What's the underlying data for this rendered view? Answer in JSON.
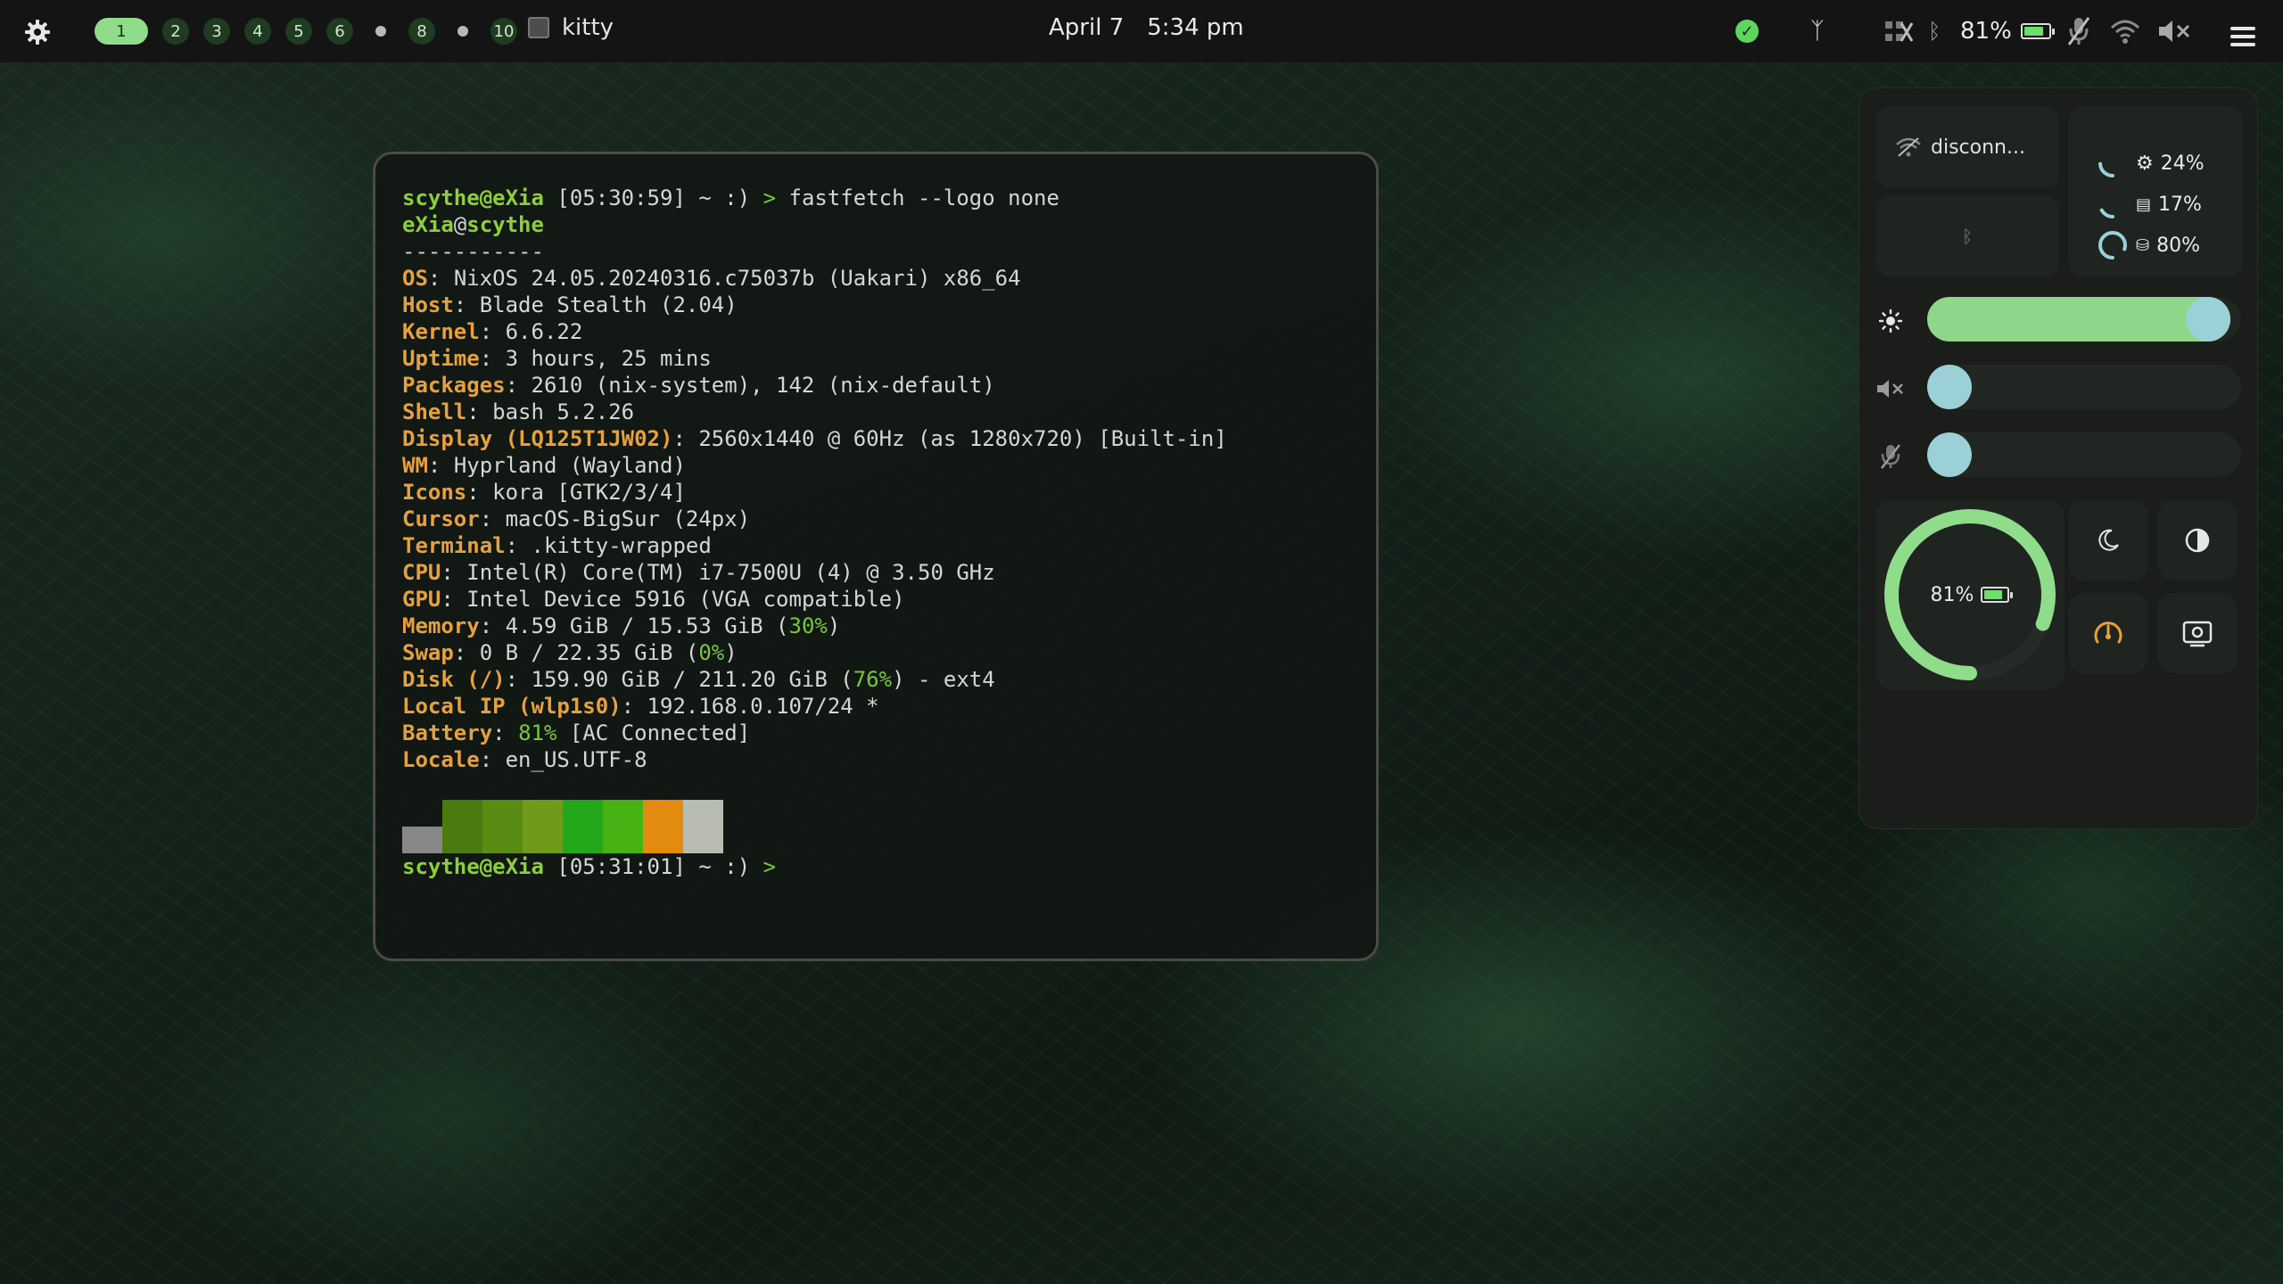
{
  "topbar": {
    "workspaces": [
      {
        "label": "1",
        "active": true
      },
      {
        "label": "2"
      },
      {
        "label": "3"
      },
      {
        "label": "4"
      },
      {
        "label": "5"
      },
      {
        "label": "6"
      },
      {
        "label": ""
      },
      {
        "label": "8"
      },
      {
        "label": ""
      },
      {
        "label": "10"
      }
    ],
    "window_title": "kitty",
    "date": "April 7",
    "time": "5:34 pm",
    "battery_percent": "81%"
  },
  "terminal": {
    "prompt1": {
      "user": "scythe@eXia",
      "time": "[05:30:59]",
      "path": "~ :)",
      "arrow": ">",
      "command": "fastfetch --logo none"
    },
    "host_user": "eXia",
    "host_at": "@",
    "host_name": "scythe",
    "separator": "-----------",
    "info": [
      {
        "key": "OS",
        "value": "NixOS 24.05.20240316.c75037b (Uakari) x86_64"
      },
      {
        "key": "Host",
        "value": "Blade Stealth (2.04)"
      },
      {
        "key": "Kernel",
        "value": "6.6.22"
      },
      {
        "key": "Uptime",
        "value": "3 hours, 25 mins"
      },
      {
        "key": "Packages",
        "value": "2610 (nix-system), 142 (nix-default)"
      },
      {
        "key": "Shell",
        "value": "bash 5.2.26"
      },
      {
        "key": "Display (LQ125T1JW02)",
        "value": "2560x1440 @ 60Hz (as 1280x720) [Built-in]"
      },
      {
        "key": "WM",
        "value": "Hyprland (Wayland)"
      },
      {
        "key": "Icons",
        "value": "kora [GTK2/3/4]"
      },
      {
        "key": "Cursor",
        "value": "macOS-BigSur (24px)"
      },
      {
        "key": "Terminal",
        "value": ".kitty-wrapped"
      },
      {
        "key": "CPU",
        "value": "Intel(R) Core(TM) i7-7500U (4) @ 3.50 GHz"
      },
      {
        "key": "GPU",
        "value": "Intel Device 5916 (VGA compatible)"
      },
      {
        "key": "Memory",
        "pre": "4.59 GiB / 15.53 GiB (",
        "pct": "30%",
        "post": ")"
      },
      {
        "key": "Swap",
        "pre": "0 B / 22.35 GiB (",
        "pct": "0%",
        "post": ")"
      },
      {
        "key": "Disk (/)",
        "pre": "159.90 GiB / 211.20 GiB (",
        "pct": "76%",
        "post": ") - ext4"
      },
      {
        "key": "Local IP (wlp1s0)",
        "value": "192.168.0.107/24 *"
      },
      {
        "key": "Battery",
        "pre": "",
        "pct": "81%",
        "post": " [AC Connected]"
      },
      {
        "key": "Locale",
        "value": "en_US.UTF-8"
      }
    ],
    "palette": [
      "#888888",
      "#4a7a10",
      "#5a8c14",
      "#6f9a1a",
      "#22a81a",
      "#47b214",
      "#e38a10",
      "#b8bcb2"
    ],
    "prompt2": {
      "user": "scythe@eXia",
      "time": "[05:31:01]",
      "path": "~ :)",
      "arrow": ">"
    }
  },
  "panel": {
    "wifi_status": "disconn...",
    "cpu": "24%",
    "ram": "17%",
    "disk": "80%",
    "brightness_level": 0.96,
    "volume_level": 0.0,
    "mic_level": 0.0,
    "battery_percent": "81%",
    "battery_level": 0.81
  },
  "colors": {
    "accent": "#8fdc8a",
    "key": "#e8a13a",
    "user": "#8ccf3a",
    "knob": "#9ad0d6"
  }
}
